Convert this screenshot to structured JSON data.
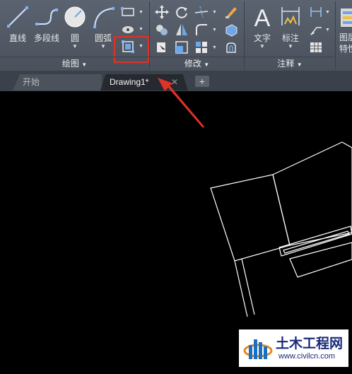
{
  "ribbon": {
    "draw_panel": {
      "title": "绘图",
      "line_label": "直线",
      "polyline_label": "多段线",
      "circle_label": "圆",
      "arc_label": "圆弧"
    },
    "modify_panel": {
      "title": "修改"
    },
    "annotation_panel": {
      "title": "注释",
      "text_label": "文字",
      "dimension_label": "标注"
    },
    "layers_panel": {
      "label_1": "图层",
      "label_2": "特性"
    }
  },
  "tabs": {
    "start_label": "开始",
    "drawing_label": "Drawing1*",
    "close_glyph": "✕",
    "add_glyph": "+"
  },
  "watermark": {
    "title": "土木工程网",
    "url": "www.civilcn.com"
  },
  "colors": {
    "highlight": "#e0312a",
    "arrow": "#e0312a",
    "canvas": "#000000",
    "lines": "#ffffff"
  }
}
